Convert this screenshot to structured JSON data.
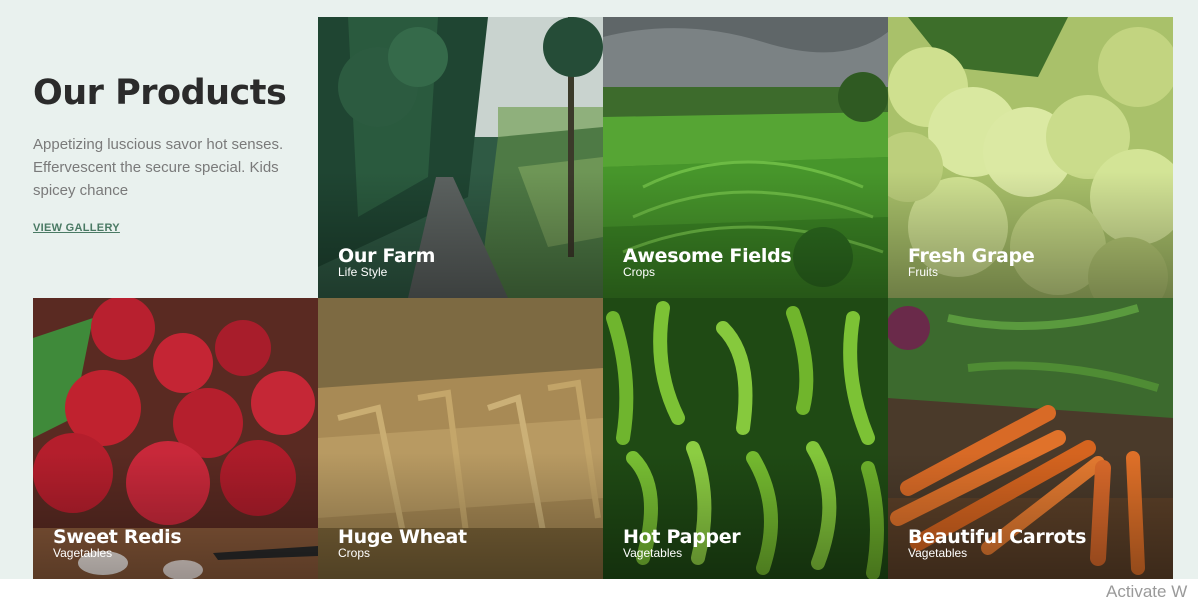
{
  "intro": {
    "title": "Our Products",
    "description": "Appetizing luscious savor hot senses. Effervescent the secure special. Kids spicey chance",
    "link_label": "VIEW GALLERY"
  },
  "tiles": [
    {
      "title": "Our Farm",
      "subtitle": "Life Style"
    },
    {
      "title": "Awesome Fields",
      "subtitle": "Crops"
    },
    {
      "title": "Fresh Grape",
      "subtitle": "Fruits"
    },
    {
      "title": "Sweet Redis",
      "subtitle": "Vagetables"
    },
    {
      "title": "Huge Wheat",
      "subtitle": "Crops"
    },
    {
      "title": "Hot Papper",
      "subtitle": "Vagetables"
    },
    {
      "title": "Beautiful Carrots",
      "subtitle": "Vagetables"
    }
  ],
  "watermark": "Activate W",
  "colors": {
    "page_background": "#e9f1ee",
    "title": "#2b2b2b",
    "link": "#4a7a64"
  }
}
